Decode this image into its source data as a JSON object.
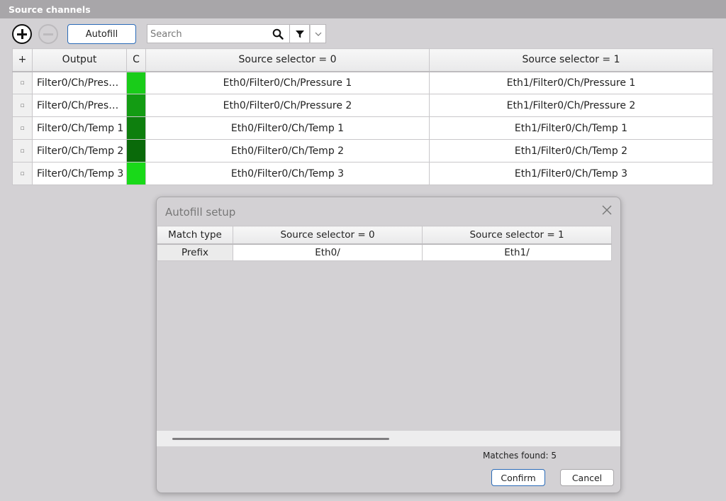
{
  "window": {
    "title": "Source channels"
  },
  "toolbar": {
    "add_icon": "plus-circle-icon",
    "remove_icon": "minus-circle-icon",
    "autofill_label": "Autofill",
    "search_placeholder": "Search",
    "search_value": ""
  },
  "grid": {
    "headers": {
      "handle": "+",
      "output": "Output",
      "color": "C",
      "sel0": "Source selector = 0",
      "sel1": "Source selector = 1"
    },
    "rows": [
      {
        "handle": "▫",
        "output": "Filter0/Ch/Pres…",
        "color": "#19cc19",
        "sel0": "Eth0/Filter0/Ch/Pressure 1",
        "sel1": "Eth1/Filter0/Ch/Pressure 1"
      },
      {
        "handle": "▫",
        "output": "Filter0/Ch/Pres…",
        "color": "#139c13",
        "sel0": "Eth0/Filter0/Ch/Pressure 2",
        "sel1": "Eth1/Filter0/Ch/Pressure 2"
      },
      {
        "handle": "▫",
        "output": "Filter0/Ch/Temp 1",
        "color": "#0e7f0e",
        "sel0": "Eth0/Filter0/Ch/Temp 1",
        "sel1": "Eth1/Filter0/Ch/Temp 1"
      },
      {
        "handle": "▫",
        "output": "Filter0/Ch/Temp 2",
        "color": "#0a6a0a",
        "sel0": "Eth0/Filter0/Ch/Temp 2",
        "sel1": "Eth1/Filter0/Ch/Temp 2"
      },
      {
        "handle": "▫",
        "output": "Filter0/Ch/Temp 3",
        "color": "#19d919",
        "sel0": "Eth0/Filter0/Ch/Temp 3",
        "sel1": "Eth1/Filter0/Ch/Temp 3"
      }
    ]
  },
  "dialog": {
    "title": "Autofill setup",
    "headers": {
      "match_type": "Match type",
      "sel0": "Source selector = 0",
      "sel1": "Source selector = 1"
    },
    "rows": [
      {
        "match_type": "Prefix",
        "sel0": "Eth0/",
        "sel1": "Eth1/"
      }
    ],
    "matches_text": "Matches found: 5",
    "confirm_label": "Confirm",
    "cancel_label": "Cancel"
  }
}
